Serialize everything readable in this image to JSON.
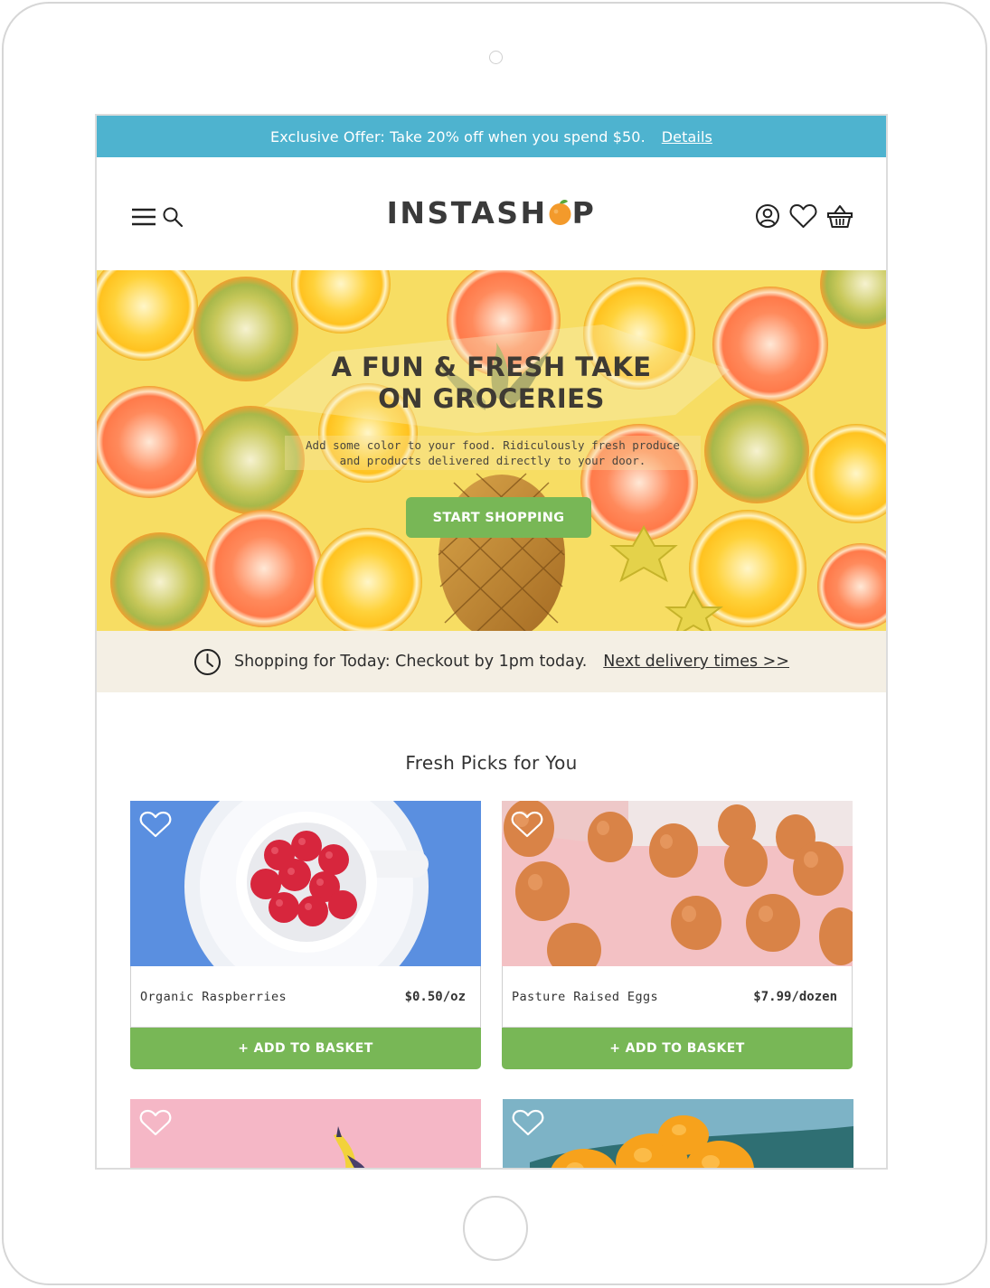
{
  "promo": {
    "text": "Exclusive Offer: Take 20% off when you spend $50.",
    "link": "Details"
  },
  "header": {
    "logo_before": "INSTASH",
    "logo_after": "P",
    "icons": [
      "menu-icon",
      "search-icon",
      "account-icon",
      "heart-icon",
      "basket-icon"
    ]
  },
  "hero": {
    "title_line1": "A FUN & FRESH TAKE",
    "title_line2": "ON GROCERIES",
    "subtitle_line1": "Add some color to your food. Ridiculously fresh produce",
    "subtitle_line2": "and products delivered directly to your door.",
    "cta": "START SHOPPING"
  },
  "delivery": {
    "text": "Shopping for Today: Checkout by 1pm today.",
    "link": "Next delivery times >>"
  },
  "picks": {
    "title": "Fresh Picks for You",
    "products": [
      {
        "name": "Organic Raspberries",
        "price": "$0.50/oz",
        "button": "+ ADD TO BASKET"
      },
      {
        "name": "Pasture Raised Eggs",
        "price": "$7.99/dozen",
        "button": "+ ADD TO BASKET"
      }
    ]
  },
  "colors": {
    "promo_bar": "#4eb3cf",
    "accent_green": "#78b756",
    "delivery_bar": "#f4efe4",
    "logo_orange": "#f39a2b"
  }
}
